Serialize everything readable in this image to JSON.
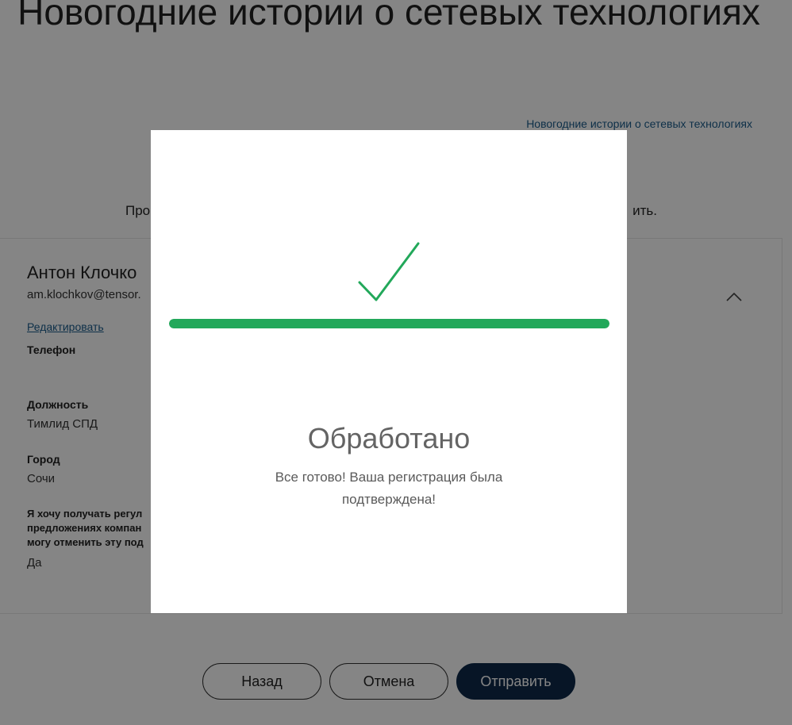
{
  "event": {
    "title": "Новогодние истории о сетевых технологиях",
    "link_text": "Новогодние истории о сетевых технологиях",
    "intro_start": "Про",
    "intro_end": "ить."
  },
  "profile": {
    "name": "Антон Клочко",
    "email": "am.klochkov@tensor.",
    "edit_label": "Редактировать",
    "phone_label": "Телефон",
    "phone_value": "",
    "position_label": "Должность",
    "position_value": "Тимлид СПД",
    "city_label": "Город",
    "city_value": "Сочи",
    "consent_label_lines": [
      "Я хочу получать регул",
      "предложениях компан",
      "могу отменить эту под"
    ],
    "consent_value": "Да",
    "chevron_icon": "chevron-up-icon"
  },
  "actions": {
    "back_label": "Назад",
    "cancel_label": "Отмена",
    "submit_label": "Отправить"
  },
  "modal": {
    "icon": "checkmark-icon",
    "progress_percent": 100,
    "title": "Обработано",
    "message": "Все готово! Ваша регистрация была подтверждена!"
  },
  "colors": {
    "success": "#22a85a",
    "primary_button": "#0e2a4a",
    "link": "#1b5d8c",
    "overlay": "rgba(0,0,0,0.48)"
  }
}
